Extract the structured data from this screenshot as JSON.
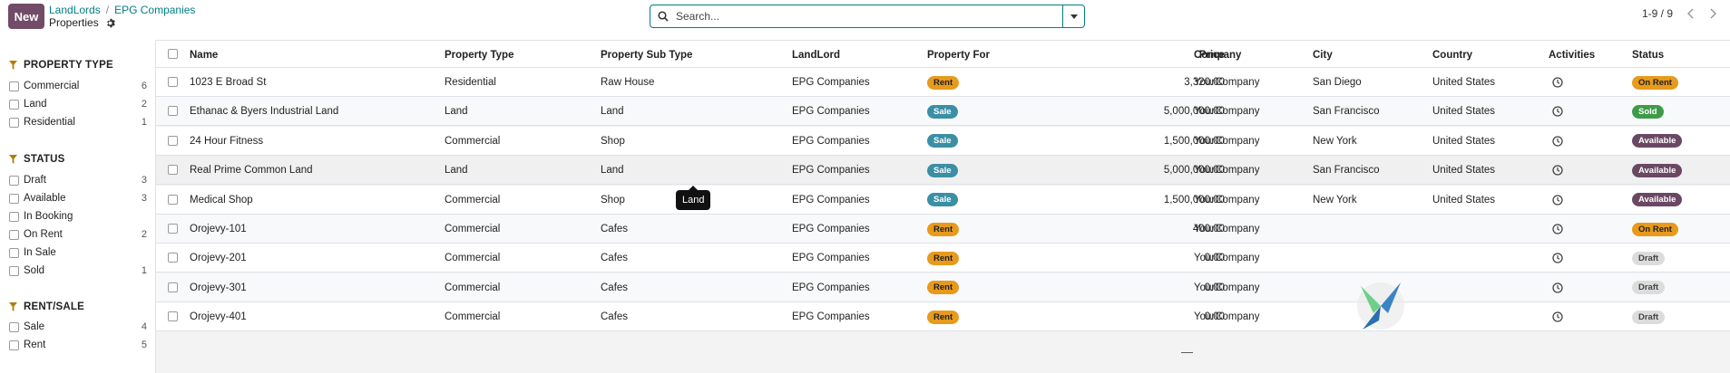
{
  "control_panel": {
    "new_label": "New",
    "breadcrumb": {
      "root": "LandLords",
      "parent": "EPG Companies",
      "current": "Properties"
    },
    "search_placeholder": "Search...",
    "pager": "1-9 / 9"
  },
  "filters": [
    {
      "title": "PROPERTY TYPE",
      "items": [
        {
          "label": "Commercial",
          "count": "6"
        },
        {
          "label": "Land",
          "count": "2"
        },
        {
          "label": "Residential",
          "count": "1"
        }
      ]
    },
    {
      "title": "STATUS",
      "items": [
        {
          "label": "Draft",
          "count": "3"
        },
        {
          "label": "Available",
          "count": "3"
        },
        {
          "label": "In Booking",
          "count": ""
        },
        {
          "label": "On Rent",
          "count": "2"
        },
        {
          "label": "In Sale",
          "count": ""
        },
        {
          "label": "Sold",
          "count": "1"
        }
      ]
    },
    {
      "title": "RENT/SALE",
      "items": [
        {
          "label": "Sale",
          "count": "4"
        },
        {
          "label": "Rent",
          "count": "5"
        }
      ]
    }
  ],
  "columns": [
    "Name",
    "Property Type",
    "Property Sub Type",
    "LandLord",
    "Property For",
    "Price",
    "Company",
    "City",
    "Country",
    "Activities",
    "Status"
  ],
  "rows": [
    {
      "name": "1023 E Broad St",
      "type": "Residential",
      "subtype": "Raw House",
      "landlord": "EPG Companies",
      "for": "Rent",
      "price": "3,320.00",
      "company": "YourCompany",
      "city": "San Diego",
      "country": "United States",
      "status": "On Rent"
    },
    {
      "name": "Ethanac & Byers Industrial Land",
      "type": "Land",
      "subtype": "Land",
      "landlord": "EPG Companies",
      "for": "Sale",
      "price": "5,000,000.00",
      "company": "YourCompany",
      "city": "San Francisco",
      "country": "United States",
      "status": "Sold"
    },
    {
      "name": "24 Hour Fitness",
      "type": "Commercial",
      "subtype": "Shop",
      "landlord": "EPG Companies",
      "for": "Sale",
      "price": "1,500,000.00",
      "company": "YourCompany",
      "city": "New York",
      "country": "United States",
      "status": "Available"
    },
    {
      "name": "Real Prime Common Land",
      "type": "Land",
      "subtype": "Land",
      "landlord": "EPG Companies",
      "for": "Sale",
      "price": "5,000,000.00",
      "company": "YourCompany",
      "city": "San Francisco",
      "country": "United States",
      "status": "Available"
    },
    {
      "name": "Medical Shop",
      "type": "Commercial",
      "subtype": "Shop",
      "landlord": "EPG Companies",
      "for": "Sale",
      "price": "1,500,000.00",
      "company": "YourCompany",
      "city": "New York",
      "country": "United States",
      "status": "Available"
    },
    {
      "name": "Orojevy-101",
      "type": "Commercial",
      "subtype": "Cafes",
      "landlord": "EPG Companies",
      "for": "Rent",
      "price": "400.00",
      "company": "YourCompany",
      "city": "",
      "country": "",
      "status": "On Rent"
    },
    {
      "name": "Orojevy-201",
      "type": "Commercial",
      "subtype": "Cafes",
      "landlord": "EPG Companies",
      "for": "Rent",
      "price": "0.00",
      "company": "YourCompany",
      "city": "",
      "country": "",
      "status": "Draft"
    },
    {
      "name": "Orojevy-301",
      "type": "Commercial",
      "subtype": "Cafes",
      "landlord": "EPG Companies",
      "for": "Rent",
      "price": "0.00",
      "company": "YourCompany",
      "city": "",
      "country": "",
      "status": "Draft"
    },
    {
      "name": "Orojevy-401",
      "type": "Commercial",
      "subtype": "Cafes",
      "landlord": "EPG Companies",
      "for": "Rent",
      "price": "0.00",
      "company": "YourCompany",
      "city": "",
      "country": "",
      "status": "Draft"
    }
  ],
  "tooltip": "Land",
  "footer_total": "—",
  "icons": {
    "search": "search-icon",
    "settings": "gear-icon",
    "filter": "funnel-icon",
    "activity": "clock-icon",
    "dropdown": "caret-down-icon"
  },
  "colors": {
    "brand": "#714B67",
    "accent": "#017e84"
  }
}
